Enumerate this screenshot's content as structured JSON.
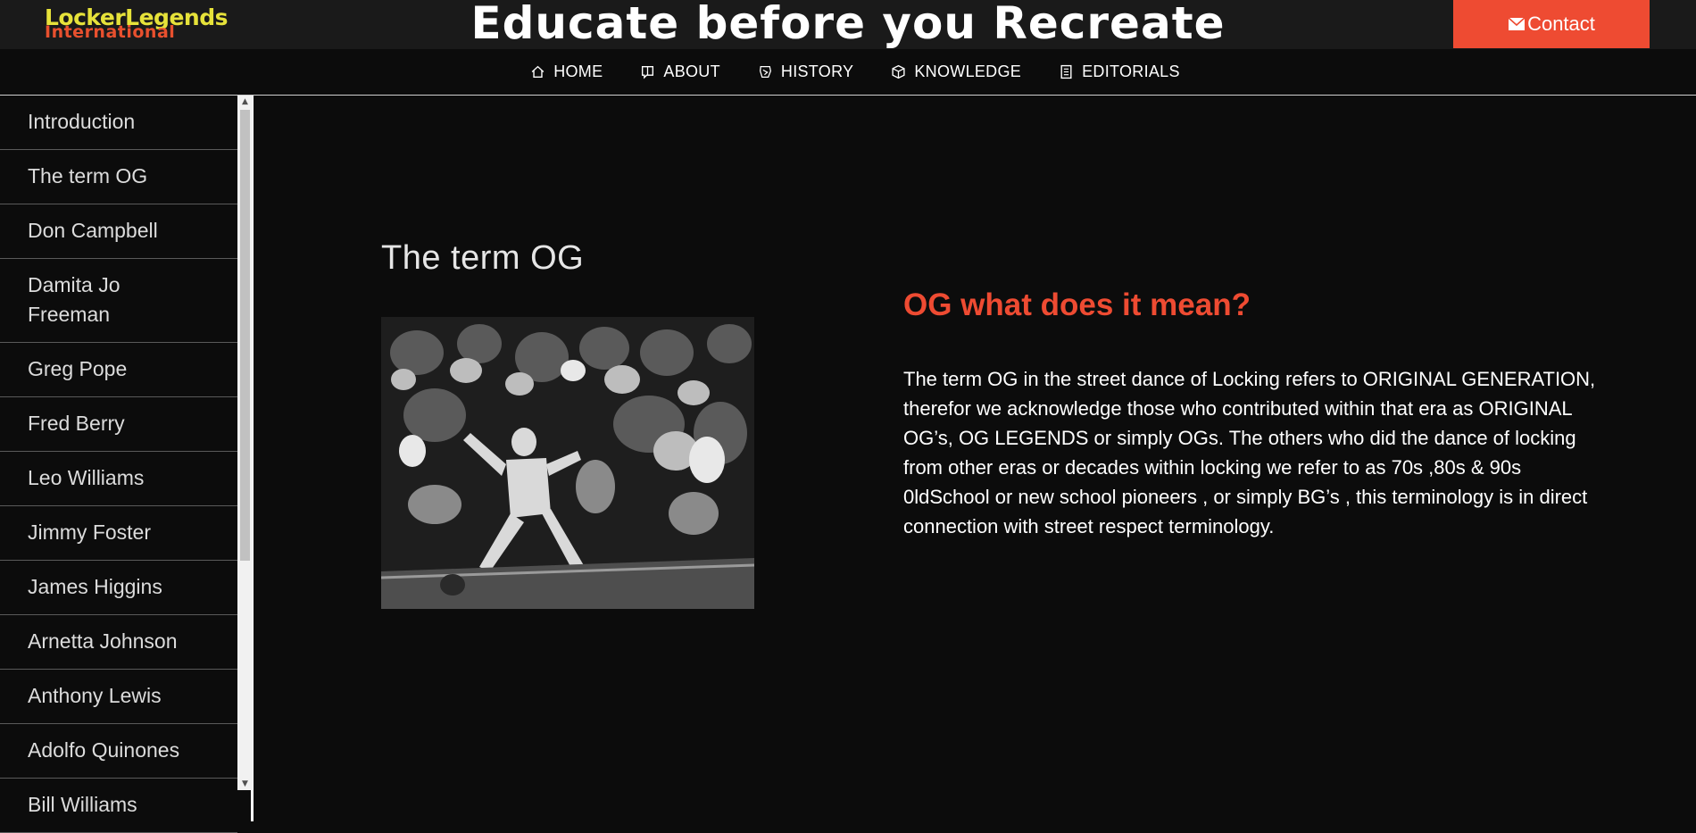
{
  "header": {
    "logo_main": "LockerLegends",
    "logo_sub": "International",
    "title": "Educate before you Recreate",
    "contact_label": "Contact"
  },
  "nav": {
    "items": [
      {
        "label": "HOME",
        "icon": "home-icon"
      },
      {
        "label": "ABOUT",
        "icon": "book-icon"
      },
      {
        "label": "HISTORY",
        "icon": "history-icon"
      },
      {
        "label": "KNOWLEDGE",
        "icon": "cube-icon"
      },
      {
        "label": "EDITORIALS",
        "icon": "document-icon"
      }
    ]
  },
  "sidebar": {
    "items": [
      {
        "label": "Introduction"
      },
      {
        "label": "The term OG"
      },
      {
        "label": "Don Campbell"
      },
      {
        "label": "Damita Jo Freeman"
      },
      {
        "label": "Greg Pope"
      },
      {
        "label": "Fred Berry"
      },
      {
        "label": "Leo Williams"
      },
      {
        "label": "Jimmy Foster"
      },
      {
        "label": "James Higgins"
      },
      {
        "label": "Arnetta Johnson"
      },
      {
        "label": "Anthony Lewis"
      },
      {
        "label": "Adolfo Quinones"
      },
      {
        "label": "Bill Williams"
      }
    ]
  },
  "main": {
    "section_title": "The term OG",
    "article_heading": "OG what does it mean?",
    "article_body": "The term OG in the street dance of Locking refers to ORIGINAL GENERATION, therefor we acknowledge those who contributed within that era as ORIGINAL OG’s, OG LEGENDS or simply OGs. The others who did the dance of locking from other eras or decades within locking we refer to as 70s ,80s & 90s 0ldSchool or new school pioneers , or simply BG’s , this terminology is in direct connection with street respect terminology."
  },
  "colors": {
    "accent": "#ee4b32",
    "logo_yellow": "#e6e23a",
    "background": "#0c0c0c",
    "header_bg": "#1a1a1a"
  }
}
